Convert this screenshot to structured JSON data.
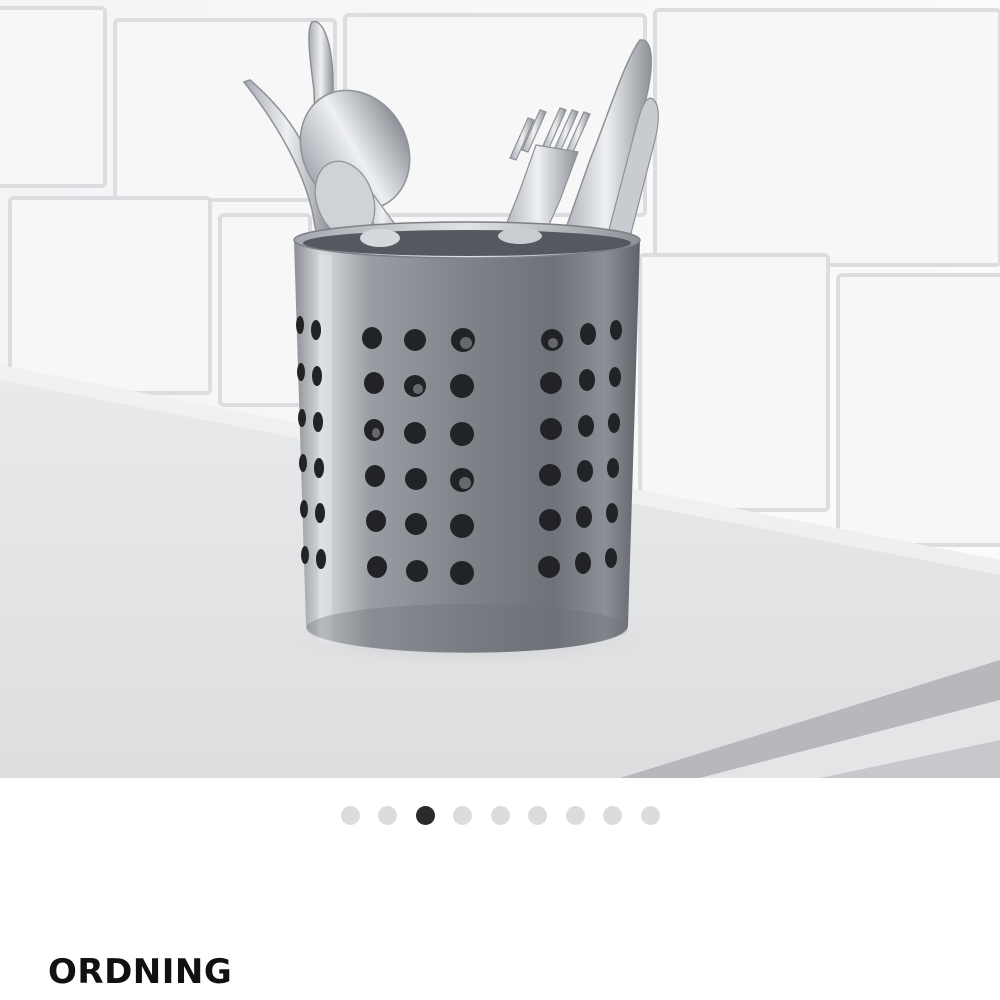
{
  "gallery": {
    "image_name": "cutlery-caddy-photo",
    "slide_count": 9,
    "active_index": 2
  },
  "product": {
    "name": "ORDNING"
  },
  "colors": {
    "dot_inactive": "#dcdcdc",
    "dot_active": "#2b2b2b",
    "title": "#111111"
  }
}
